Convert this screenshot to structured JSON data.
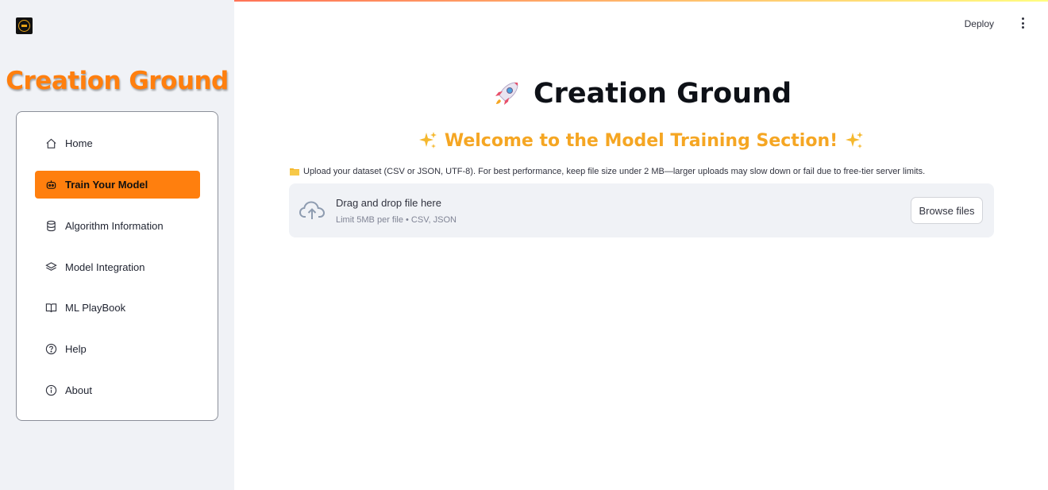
{
  "app": {
    "brand_title": "Creation Ground",
    "deploy_label": "Deploy",
    "accent_color": "#ff7f0e"
  },
  "sidebar": {
    "items": [
      {
        "label": "Home",
        "icon": "home-icon",
        "active": false
      },
      {
        "label": "Train Your Model",
        "icon": "robot-icon",
        "active": true
      },
      {
        "label": "Algorithm Information",
        "icon": "database-icon",
        "active": false
      },
      {
        "label": "Model Integration",
        "icon": "layers-icon",
        "active": false
      },
      {
        "label": "ML PlayBook",
        "icon": "book-icon",
        "active": false
      },
      {
        "label": "Help",
        "icon": "question-circle-icon",
        "active": false
      },
      {
        "label": "About",
        "icon": "info-circle-icon",
        "active": false
      }
    ]
  },
  "main": {
    "title": "Creation Ground",
    "welcome": "Welcome to the Model Training Section!",
    "upload_note": "Upload your dataset (CSV or JSON, UTF-8). For best performance, keep file size under 2 MB—larger uploads may slow down or fail due to free-tier server limits.",
    "uploader": {
      "drag_text": "Drag and drop file here",
      "limit_text": "Limit 5MB per file • CSV, JSON",
      "browse_label": "Browse files"
    }
  }
}
